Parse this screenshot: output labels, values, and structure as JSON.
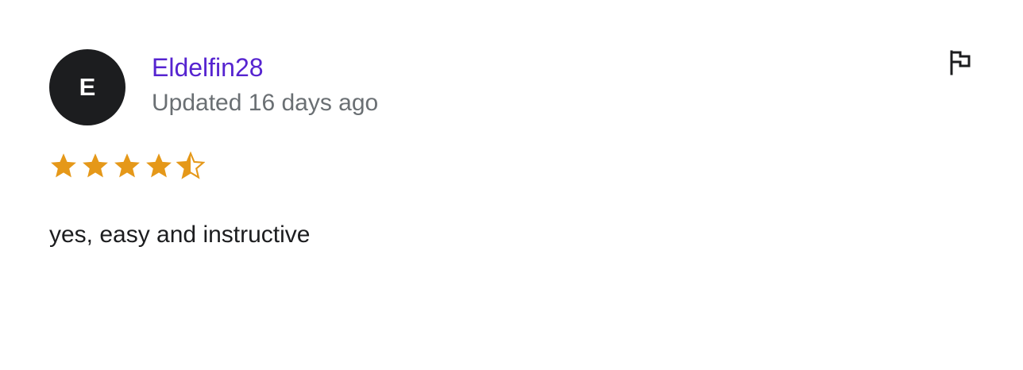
{
  "review": {
    "avatar_initial": "E",
    "author": "Eldelfin28",
    "updated": "Updated 16 days ago",
    "rating": 4.5,
    "rating_max": 5,
    "comment": "yes, easy and instructive",
    "flag_icon": "flag-icon"
  },
  "colors": {
    "star": "#e59819",
    "author_link": "#5624d0",
    "avatar_bg": "#1c1d1f",
    "muted_text": "#6a6f73"
  }
}
